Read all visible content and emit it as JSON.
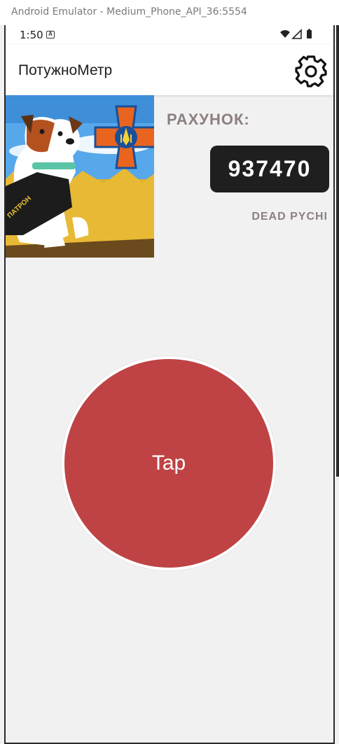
{
  "window": {
    "title": "Android Emulator - Medium_Phone_API_36:5554"
  },
  "status_bar": {
    "time": "1:50",
    "notification_icon": "a-badge-icon",
    "icons": [
      "wifi-icon",
      "signal-icon",
      "battery-icon"
    ]
  },
  "app_bar": {
    "title": "ПотужноМетр",
    "settings_icon": "gear-icon"
  },
  "hero_image": {
    "badge_text": "ПАТРОН"
  },
  "score": {
    "label": "РАХУНОК:",
    "value": "937470",
    "rank": "DEAD PYCHI"
  },
  "tap": {
    "label": "Tap",
    "color": "#bf4344"
  }
}
